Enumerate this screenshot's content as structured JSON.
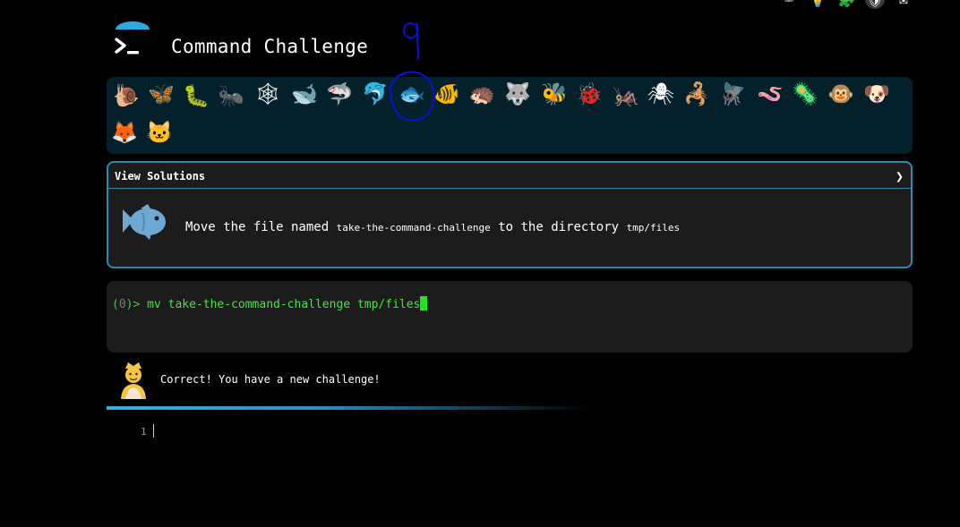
{
  "app": {
    "title": "Command Challenge"
  },
  "extensions": [
    {
      "icon": "terminal-ext-icon",
      "glyph": "⌨"
    },
    {
      "icon": "lightbulb-ext-icon",
      "glyph": "💡"
    },
    {
      "icon": "puzzle-ext-icon",
      "glyph": "🧩"
    },
    {
      "icon": "shield-ext-icon",
      "glyph": "🛡"
    },
    {
      "icon": "mail-ext-icon",
      "glyph": "✉"
    }
  ],
  "annotation": {
    "text": "9",
    "color": "#0a10d8"
  },
  "animals": [
    {
      "name": "snail",
      "glyph": "🐌"
    },
    {
      "name": "butterfly",
      "glyph": "🦋"
    },
    {
      "name": "caterpillar",
      "glyph": "🐛"
    },
    {
      "name": "ant",
      "glyph": "🐜"
    },
    {
      "name": "spider-web",
      "glyph": "🕸"
    },
    {
      "name": "whale",
      "glyph": "🐋"
    },
    {
      "name": "shark",
      "glyph": "🦈"
    },
    {
      "name": "dolphin",
      "glyph": "🐬"
    },
    {
      "name": "fish",
      "glyph": "🐟"
    },
    {
      "name": "tropical-fish",
      "glyph": "🐠"
    },
    {
      "name": "hedgehog",
      "glyph": "🦔"
    },
    {
      "name": "wolf",
      "glyph": "🐺"
    },
    {
      "name": "bee",
      "glyph": "🐝"
    },
    {
      "name": "ladybug",
      "glyph": "🐞"
    },
    {
      "name": "cricket",
      "glyph": "🦗"
    },
    {
      "name": "spider",
      "glyph": "🕷"
    },
    {
      "name": "scorpion",
      "glyph": "🦂"
    },
    {
      "name": "fly",
      "glyph": "🪰"
    },
    {
      "name": "worm",
      "glyph": "🪱"
    },
    {
      "name": "microbe",
      "glyph": "🦠"
    },
    {
      "name": "monkey",
      "glyph": "🐵"
    },
    {
      "name": "dog",
      "glyph": "🐶"
    },
    {
      "name": "fox",
      "glyph": "🦊"
    },
    {
      "name": "cat",
      "glyph": "🐱"
    }
  ],
  "challenge": {
    "view_solutions": "View Solutions",
    "chevron": "❯",
    "task_prefix": "Move the file named ",
    "task_file": "take-the-command-challenge",
    "task_middle": " to the directory ",
    "task_dir": "tmp/files"
  },
  "terminal": {
    "prompt_open": "(",
    "prompt_count": "0",
    "prompt_close": ")> ",
    "command": "mv take-the-command-challenge tmp/files"
  },
  "feedback": {
    "message": "Correct! You have a new challenge!"
  },
  "editor": {
    "line_number": "1"
  },
  "colors": {
    "accent": "#2c8ab3",
    "panel": "#03202b",
    "terminal_green": "#3fe83f"
  }
}
